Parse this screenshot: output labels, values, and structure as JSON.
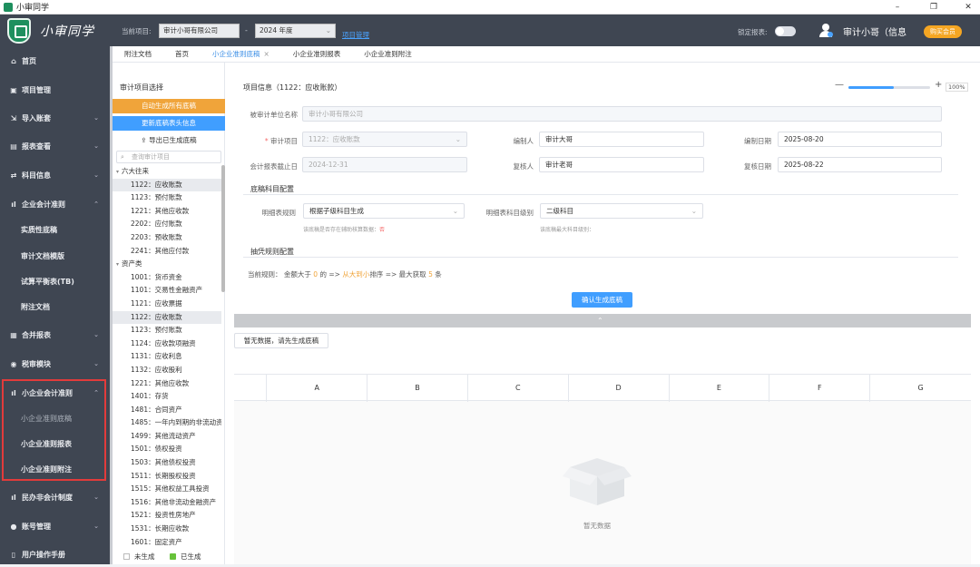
{
  "window": {
    "title": "小审同学",
    "controls": [
      "–",
      "❐",
      "✕"
    ]
  },
  "header": {
    "brand": "小审同学",
    "project_label": "当前项目:",
    "project_value": "审计小哥有限公司",
    "dash": "-",
    "year_value": "2024 年度",
    "project_mgmt_link": "项目管理",
    "lock_label": "锁定报表:",
    "user_name": "审计小哥（信息",
    "buy_label": "购买会员"
  },
  "sidebar": {
    "items": [
      {
        "label": "首页",
        "icon": "home-icon",
        "glyph": "⌂"
      },
      {
        "label": "项目管理",
        "icon": "folder-icon",
        "glyph": "▣"
      },
      {
        "label": "导入账套",
        "icon": "import-icon",
        "glyph": "⇲"
      },
      {
        "label": "报表查看",
        "icon": "report-icon",
        "glyph": "▤"
      },
      {
        "label": "科目信息",
        "icon": "subject-icon",
        "glyph": "⇄"
      },
      {
        "label": "企业会计准则",
        "icon": "chart-icon",
        "glyph": "ıl"
      },
      {
        "label": "实质性底稿"
      },
      {
        "label": "审计文档模版"
      },
      {
        "label": "试算平衡表(TB)"
      },
      {
        "label": "附注文档"
      },
      {
        "label": "合并报表",
        "icon": "merge-icon",
        "glyph": "▦"
      },
      {
        "label": "税审模块",
        "icon": "tax-icon",
        "glyph": "◉"
      },
      {
        "label": "小企业会计准则",
        "icon": "chart-icon",
        "glyph": "ıl"
      },
      {
        "label": "小企业准则底稿"
      },
      {
        "label": "小企业准则报表"
      },
      {
        "label": "小企业准则附注"
      },
      {
        "label": "民办非会计制度",
        "icon": "chart-icon",
        "glyph": "ıl"
      },
      {
        "label": "账号管理",
        "icon": "user-icon",
        "glyph": "●"
      },
      {
        "label": "用户操作手册",
        "icon": "manual-icon",
        "glyph": "▯"
      }
    ]
  },
  "tabs": [
    {
      "label": "附注文档"
    },
    {
      "label": "首页"
    },
    {
      "label": "小企业准则底稿",
      "close": "×"
    },
    {
      "label": "小企业准则报表"
    },
    {
      "label": "小企业准则附注"
    }
  ],
  "left_panel": {
    "title": "审计项目选择",
    "btn_generate_all": "自动生成所有底稿",
    "btn_update_header": "更新底稿表头信息",
    "btn_export": "导出已生成底稿",
    "search_placeholder": "查询审计项目",
    "tree": [
      {
        "label": "六大往来",
        "group": true
      },
      {
        "label": "1122：应收账款",
        "selected": true
      },
      {
        "label": "1123：预付账款"
      },
      {
        "label": "1221：其他应收款"
      },
      {
        "label": "2202：应付账款"
      },
      {
        "label": "2203：预收账款"
      },
      {
        "label": "2241：其他应付款"
      },
      {
        "label": "资产类",
        "group": true
      },
      {
        "label": "1001：货币资金"
      },
      {
        "label": "1101：交易性金融资产"
      },
      {
        "label": "1121：应收票据"
      },
      {
        "label": "1122：应收账款",
        "selected": true
      },
      {
        "label": "1123：预付账款"
      },
      {
        "label": "1124：应收款项融资"
      },
      {
        "label": "1131：应收利息"
      },
      {
        "label": "1132：应收股利"
      },
      {
        "label": "1221：其他应收款"
      },
      {
        "label": "1401：存货"
      },
      {
        "label": "1481：合同资产"
      },
      {
        "label": "1485：一年内到期的非流动资产"
      },
      {
        "label": "1499：其他流动资产"
      },
      {
        "label": "1501：债权投资"
      },
      {
        "label": "1503：其他债权投资"
      },
      {
        "label": "1511：长期股权投资"
      },
      {
        "label": "1515：其他权益工具投资"
      },
      {
        "label": "1516：其他非流动金融资产"
      },
      {
        "label": "1521：投资性房地产"
      },
      {
        "label": "1531：长期应收款"
      },
      {
        "label": "1601：固定资产"
      }
    ],
    "legend_not_generated": "未生成",
    "legend_generated": "已生成"
  },
  "main": {
    "section_project": "项目信息（1122：应收账款）",
    "zoom": {
      "minus": "—",
      "plus": "+",
      "pct": "100%",
      "level": 0.55
    },
    "fields": {
      "unit_label": "被审计单位名称",
      "unit_value": "审计小哥有限公司",
      "item_label": "审计项目",
      "item_value": "1122：应收账款",
      "preparer_label": "编制人",
      "preparer_value": "审计大哥",
      "prep_date_label": "编制日期",
      "prep_date_value": "2025-08-20",
      "period_label": "会计报表截止日",
      "period_value": "2024-12-31",
      "reviewer_label": "复核人",
      "reviewer_value": "审计老哥",
      "review_date_label": "复核日期",
      "review_date_value": "2025-08-22"
    },
    "section_config": "底稿科目配置",
    "detail_rule_label": "明细表规则",
    "detail_rule_value": "根据子级科目生成",
    "detail_hint": "该底稿是否存在辅助核算数据：",
    "detail_hint_value": "否",
    "level_label": "明细表科目级别",
    "level_value": "二级科目",
    "level_hint": "该底稿最大科目级别：",
    "section_sampling": "抽凭规则配置",
    "rule_prefix": "当前规则：",
    "rule_amount": "金额大于",
    "rule_amount_val": "0",
    "rule_unit": "的",
    "rule_arrow1": "=>",
    "rule_sort": "从大到小",
    "rule_sort_suffix": "排序",
    "rule_arrow2": "=>",
    "rule_max": "最大获取",
    "rule_max_val": "5",
    "rule_count": "条",
    "confirm_btn": "确认生成底稿",
    "collapse_glyph": "⌃",
    "nodata_btn": "暂无数据，请先生成底稿",
    "grid_columns": [
      "A",
      "B",
      "C",
      "D",
      "E",
      "F",
      "G"
    ],
    "empty_text": "暂无数据"
  }
}
